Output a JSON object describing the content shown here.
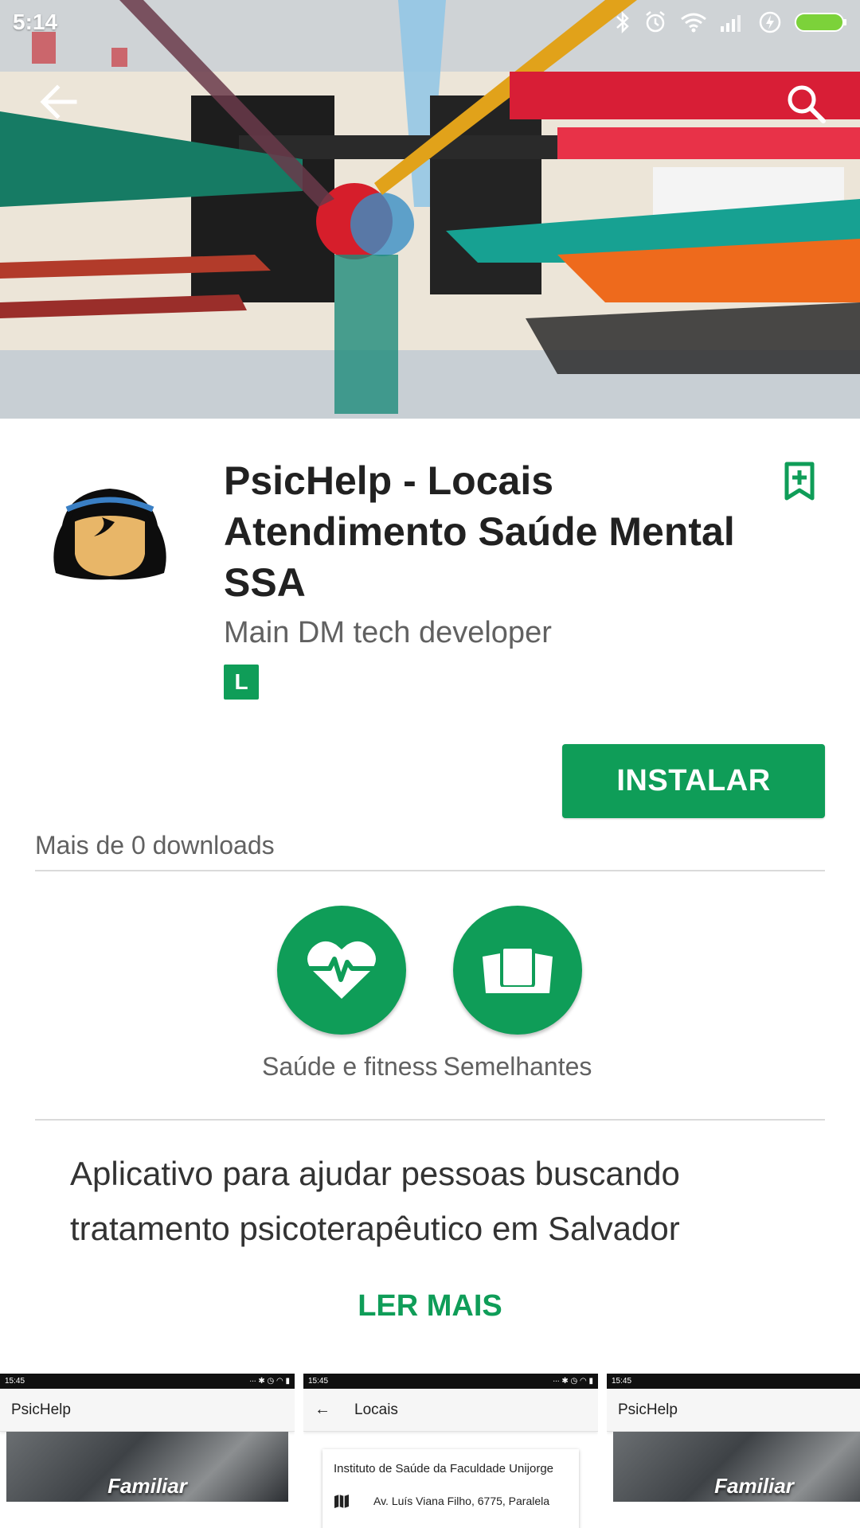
{
  "status_bar": {
    "time": "5:14",
    "icons": [
      "bluetooth-icon",
      "alarm-icon",
      "wifi-icon",
      "signal-icon",
      "battery-charging-icon",
      "battery-icon"
    ]
  },
  "hero": {
    "image": "abstract-painting-banner",
    "back_icon": "arrow-back-icon",
    "search_icon": "search-icon"
  },
  "app": {
    "title": "PsicHelp - Locais Atendimento Saúde Mental SSA",
    "developer": "Main DM tech developer",
    "content_rating": "L",
    "install_label": "INSTALAR",
    "downloads": "Mais de 0 downloads",
    "wishlist_icon": "bookmark-add-icon"
  },
  "chips": [
    {
      "label": "Saúde e fitness",
      "icon": "heart-pulse-icon"
    },
    {
      "label": "Semelhantes",
      "icon": "cards-icon"
    }
  ],
  "description": {
    "text": "Aplicativo para ajudar pessoas buscando tratamento psicoterapêutico em Salvador",
    "read_more": "LER MAIS"
  },
  "screenshots": [
    {
      "time": "15:45",
      "toolbar": "PsicHelp",
      "photo_label": "Familiar"
    },
    {
      "time": "15:45",
      "toolbar": "Locais",
      "card_title": "Instituto de Saúde da Faculdade Unijorge",
      "card_address": "Av. Luís Viana Filho, 6775, Paralela"
    },
    {
      "time": "15:45",
      "toolbar": "PsicHelp",
      "photo_label": "Familiar"
    }
  ],
  "colors": {
    "accent": "#0f9d58",
    "text_primary": "#212121",
    "text_secondary": "#616161"
  }
}
